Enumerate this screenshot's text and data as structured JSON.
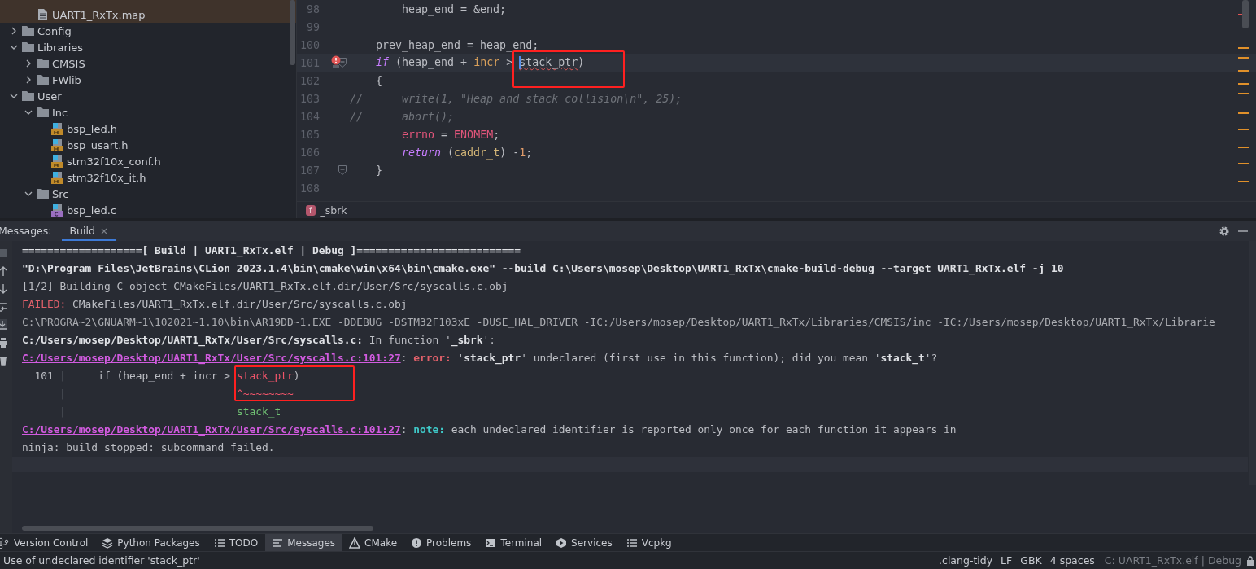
{
  "project_tree": {
    "cut_children": [
      {
        "label": "UART1_RxTx.map",
        "kind": "text-file",
        "highlighted": true
      }
    ],
    "items": [
      {
        "label": "Config",
        "kind": "folder",
        "expanded": false
      },
      {
        "label": "Libraries",
        "kind": "folder",
        "expanded": true,
        "children": [
          {
            "label": "CMSIS",
            "kind": "folder",
            "expanded": false
          },
          {
            "label": "FWlib",
            "kind": "folder",
            "expanded": false
          }
        ]
      },
      {
        "label": "User",
        "kind": "folder",
        "expanded": true,
        "children": [
          {
            "label": "Inc",
            "kind": "folder",
            "expanded": true,
            "children": [
              {
                "label": "bsp_led.h",
                "kind": "header"
              },
              {
                "label": "bsp_usart.h",
                "kind": "header"
              },
              {
                "label": "stm32f10x_conf.h",
                "kind": "header"
              },
              {
                "label": "stm32f10x_it.h",
                "kind": "header"
              }
            ]
          },
          {
            "label": "Src",
            "kind": "folder",
            "expanded": true,
            "children": [
              {
                "label": "bsp_led.c",
                "kind": "c-source"
              }
            ]
          }
        ]
      }
    ]
  },
  "editor": {
    "lines": [
      {
        "number": "98",
        "tokens": [
          {
            "kind": "plain",
            "text": "        heap_end = &end;"
          }
        ]
      },
      {
        "number": "99"
      },
      {
        "number": "100",
        "tokens": [
          {
            "kind": "plain",
            "text": "    prev_heap_end = heap_end;"
          }
        ]
      },
      {
        "number": "101",
        "current": true,
        "fold": true,
        "error": true,
        "tokens": [
          {
            "kind": "keyword",
            "text": "    if"
          },
          {
            "kind": "plain",
            "text": " (heap_end + "
          },
          {
            "kind": "param",
            "text": "incr"
          },
          {
            "kind": "plain",
            "text": " > "
          },
          {
            "kind": "error",
            "text": "stack_ptr",
            "caret": true,
            "boxed": true
          },
          {
            "kind": "plain",
            "text": ")"
          }
        ]
      },
      {
        "number": "102",
        "tokens": [
          {
            "kind": "plain",
            "text": "    {"
          }
        ]
      },
      {
        "number": "103",
        "tokens": [
          {
            "kind": "comment",
            "text": "//      write(1, \"Heap and stack collision\\n\", 25);"
          }
        ]
      },
      {
        "number": "104",
        "tokens": [
          {
            "kind": "comment",
            "text": "//      abort();"
          }
        ]
      },
      {
        "number": "105",
        "tokens": [
          {
            "kind": "macro",
            "text": "        errno"
          },
          {
            "kind": "plain",
            "text": " = "
          },
          {
            "kind": "macro",
            "text": "ENOMEM"
          },
          {
            "kind": "plain",
            "text": ";"
          }
        ]
      },
      {
        "number": "106",
        "tokens": [
          {
            "kind": "keyword",
            "text": "        return"
          },
          {
            "kind": "plain",
            "text": " ("
          },
          {
            "kind": "type",
            "text": "caddr_t"
          },
          {
            "kind": "plain",
            "text": ") -"
          },
          {
            "kind": "number",
            "text": "1"
          },
          {
            "kind": "plain",
            "text": ";"
          }
        ]
      },
      {
        "number": "107",
        "fold": true,
        "tokens": [
          {
            "kind": "plain",
            "text": "    }"
          }
        ]
      },
      {
        "number": "108"
      }
    ],
    "breadcrumb": {
      "badge": "f",
      "label": "_sbrk"
    }
  },
  "messages": {
    "title": "Messages:",
    "tabs": [
      {
        "label": "Build",
        "selected": true
      }
    ],
    "output": [
      [
        {
          "kind": "bold",
          "text": "===================[ Build | UART1_RxTx.elf | Debug ]=========================="
        }
      ],
      [
        {
          "kind": "bold",
          "text": "\"D:\\Program Files\\JetBrains\\CLion 2023.1.4\\bin\\cmake\\win\\x64\\bin\\cmake.exe\" --build C:\\Users\\mosep\\Desktop\\UART1_RxTx\\cmake-build-debug --target UART1_RxTx.elf -j 10"
        }
      ],
      [
        {
          "kind": "plain",
          "text": "[1/2] Building C object CMakeFiles/UART1_RxTx.elf.dir/User/Src/syscalls.c.obj"
        }
      ],
      [
        {
          "kind": "failed",
          "text": "FAILED:"
        },
        {
          "kind": "plain",
          "text": " CMakeFiles/UART1_RxTx.elf.dir/User/Src/syscalls.c.obj"
        }
      ],
      [
        {
          "kind": "dim",
          "text": "C:\\PROGRA~2\\GNUARM~1\\102021~1.10\\bin\\AR19DD~1.EXE -DDEBUG -DSTM32F103xE -DUSE_HAL_DRIVER -IC:/Users/mosep/Desktop/UART1_RxTx/Libraries/CMSIS/inc -IC:/Users/mosep/Desktop/UART1_RxTx/Librarie"
        }
      ],
      [
        {
          "kind": "bold",
          "text": "C:/Users/mosep/Desktop/UART1_RxTx/User/Src/syscalls.c:"
        },
        {
          "kind": "plain",
          "text": " In function '"
        },
        {
          "kind": "bold",
          "text": "_sbrk"
        },
        {
          "kind": "plain",
          "text": "':"
        }
      ],
      [
        {
          "kind": "link",
          "text": "C:/Users/mosep/Desktop/UART1_RxTx/User/Src/syscalls.c:101:27"
        },
        {
          "kind": "plain",
          "text": ": "
        },
        {
          "kind": "error",
          "text": "error:"
        },
        {
          "kind": "plain",
          "text": " '"
        },
        {
          "kind": "bold",
          "text": "stack_ptr"
        },
        {
          "kind": "plain",
          "text": "' undeclared (first use in this function); did you mean '"
        },
        {
          "kind": "bold",
          "text": "stack_t"
        },
        {
          "kind": "plain",
          "text": "'?"
        }
      ],
      [
        {
          "kind": "plain",
          "text": "  101 |     if (heap_end + incr > "
        },
        {
          "kind": "red",
          "text": "stack_ptr",
          "boxed": true
        },
        {
          "kind": "plain",
          "text": ")"
        }
      ],
      [
        {
          "kind": "plain",
          "text": "      |                           "
        },
        {
          "kind": "red",
          "text": "^~~~~~~~~"
        }
      ],
      [
        {
          "kind": "plain",
          "text": "      |                           "
        },
        {
          "kind": "green",
          "text": "stack_t"
        }
      ],
      [
        {
          "kind": "link",
          "text": "C:/Users/mosep/Desktop/UART1_RxTx/User/Src/syscalls.c:101:27"
        },
        {
          "kind": "plain",
          "text": ": "
        },
        {
          "kind": "note",
          "text": "note:"
        },
        {
          "kind": "plain",
          "text": " each undeclared identifier is reported only once for each function it appears in"
        }
      ],
      [
        {
          "kind": "plain",
          "text": "ninja: build stopped: subcommand failed."
        }
      ]
    ]
  },
  "tool_windows": [
    {
      "label": "Version Control",
      "kind": "branch",
      "selected": false
    },
    {
      "label": "Python Packages",
      "kind": "layers",
      "selected": false
    },
    {
      "label": "TODO",
      "kind": "list",
      "selected": false
    },
    {
      "label": "Messages",
      "kind": "lines",
      "selected": true
    },
    {
      "label": "CMake",
      "kind": "triangle",
      "selected": false
    },
    {
      "label": "Problems",
      "kind": "alert",
      "selected": false
    },
    {
      "label": "Terminal",
      "kind": "terminal",
      "selected": false
    },
    {
      "label": "Services",
      "kind": "play",
      "selected": false
    },
    {
      "label": "Vcpkg",
      "kind": "list",
      "selected": false
    }
  ],
  "status_bar": {
    "message": "Use of undeclared identifier 'stack_ptr'",
    "items": [
      {
        "label": ".clang-tidy"
      },
      {
        "label": "LF"
      },
      {
        "label": "GBK"
      },
      {
        "label": "4 spaces"
      },
      {
        "label": "C: UART1_RxTx.elf | Debug",
        "dim": true
      }
    ]
  }
}
